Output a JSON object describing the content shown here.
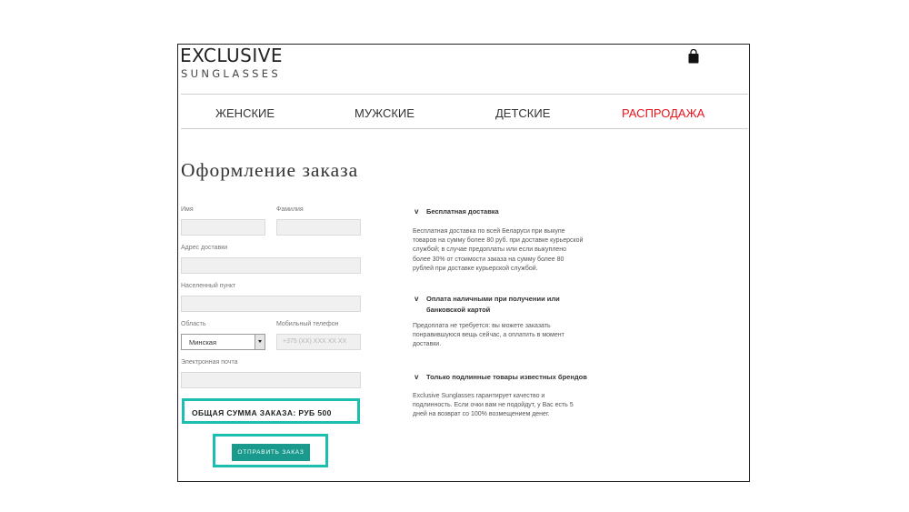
{
  "brand": {
    "name": "EXCLUSIVE",
    "tagline": "SUNGLASSES"
  },
  "header": {
    "cart_icon": "shopping-bag-icon"
  },
  "nav": {
    "items": [
      {
        "label": "ЖЕНСКИЕ"
      },
      {
        "label": "МУЖСКИЕ"
      },
      {
        "label": "ДЕТСКИЕ"
      },
      {
        "label": "РАСПРОДАЖА",
        "color": "#e8141c"
      }
    ]
  },
  "page": {
    "title": "Оформление заказа"
  },
  "form": {
    "first_name": {
      "label": "Имя",
      "value": ""
    },
    "last_name": {
      "label": "Фамилия",
      "value": ""
    },
    "address": {
      "label": "Адрес доставки",
      "value": ""
    },
    "city": {
      "label": "Населенный пункт",
      "value": ""
    },
    "region": {
      "label": "Область",
      "value": "Минская"
    },
    "phone": {
      "label": "Мобильный телефон",
      "placeholder": "+375 (XX) XXX XX XX",
      "value": ""
    },
    "email": {
      "label": "Электронная почта",
      "value": ""
    },
    "total": "ОБЩАЯ СУММА ЗАКАЗА: РУБ 500",
    "submit": "ОТПРАВИТЬ ЗАКАЗ"
  },
  "info": [
    {
      "title": "Бесплатная доставка",
      "body": "Бесплатная доставка по всей Беларуси при выкупе товаров на сумму более 80 руб. при доставке курьерской службой; в случае предоплаты или если выкуплено более 30% от стоимости заказа на сумму более 80 рублей при доставке курьерской службой."
    },
    {
      "title": "Оплата наличными при получении или банковской картой",
      "body": "Предоплата не требуется: вы можете заказать понравившуюся вещь сейчас, а оплатить в момент доставки."
    },
    {
      "title": "Только подлинные товары известных брендов",
      "body": "Exclusive Sunglasses гарантирует качество и подлинность. Если очки вам не подойдут, у Вас есть 5 дней на возврат со 100% возмещением денег."
    }
  ],
  "colors": {
    "accent": "#1bbfb0",
    "button": "#1a9a8d",
    "sale": "#e8141c"
  }
}
